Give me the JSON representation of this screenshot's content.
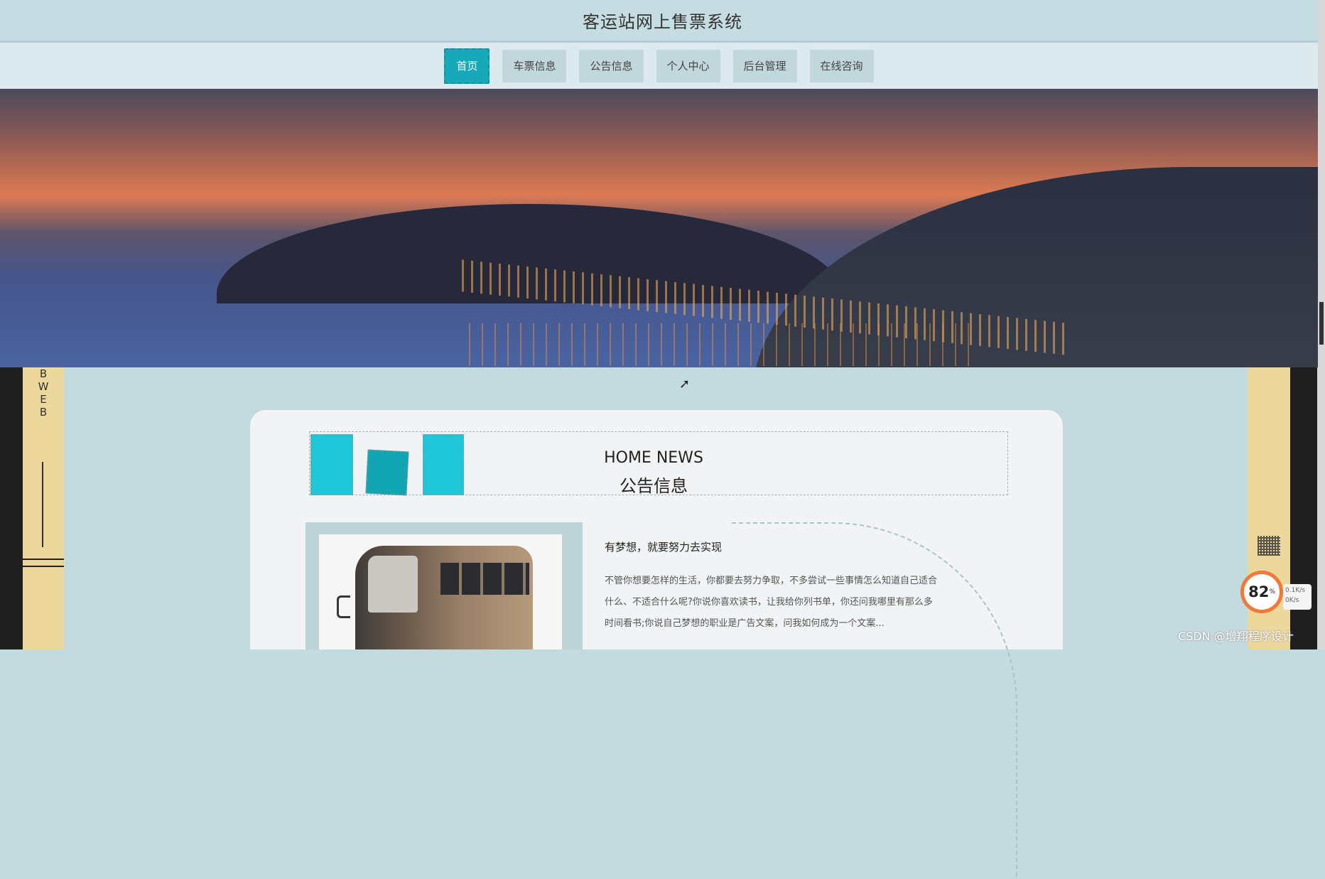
{
  "header": {
    "title": "客运站网上售票系统"
  },
  "nav": {
    "items": [
      {
        "label": "首页",
        "active": true
      },
      {
        "label": "车票信息"
      },
      {
        "label": "公告信息"
      },
      {
        "label": "个人中心"
      },
      {
        "label": "后台管理"
      },
      {
        "label": "在线咨询"
      }
    ]
  },
  "side_left": {
    "vertical_text": "B W E B"
  },
  "news": {
    "title_en": "HOME NEWS",
    "title_cn": "公告信息",
    "article": {
      "title": "有梦想，就要努力去实现",
      "body": "不管你想要怎样的生活，你都要去努力争取，不多尝试一些事情怎么知道自己适合什么、不适合什么呢?你说你喜欢读书，让我给你列书单，你还问我哪里有那么多时间看书;你说自己梦想的职业是广告文案，问我如何成为一个文案..."
    }
  },
  "overlay": {
    "speed_value": "82",
    "speed_unit": "%",
    "speed_up": "0.1K/s",
    "speed_down": "0K/s"
  },
  "watermark": "CSDN @增翔程序设计",
  "colors": {
    "accent": "#17a8ba",
    "header_bg": "#c5dde2",
    "nav_bg": "#dce9ee",
    "tan": "#ecd79c"
  }
}
